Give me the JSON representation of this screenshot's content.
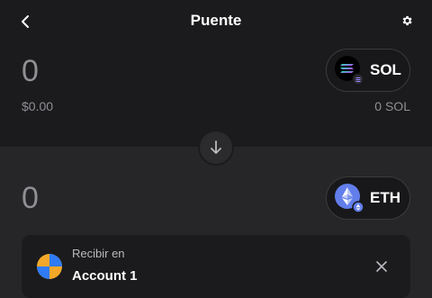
{
  "header": {
    "title": "Puente",
    "back_icon": "chevron-left-icon",
    "settings_icon": "gear-icon"
  },
  "from": {
    "amount": "0",
    "fiat_value": "$0.00",
    "token_symbol": "SOL",
    "balance": "0 SOL",
    "token_icon": "solana-logo-icon"
  },
  "swap": {
    "icon": "arrow-down-icon"
  },
  "to": {
    "amount": "0",
    "token_symbol": "ETH",
    "token_icon": "ethereum-logo-icon"
  },
  "receive": {
    "label": "Recibir en",
    "account": "Account 1",
    "avatar_icon": "account-avatar-icon",
    "close_icon": "close-icon"
  },
  "colors": {
    "top_panel": "#1b1b1d",
    "background": "#262628",
    "muted_text": "#8f8f94",
    "eth_accent": "#627eea"
  }
}
